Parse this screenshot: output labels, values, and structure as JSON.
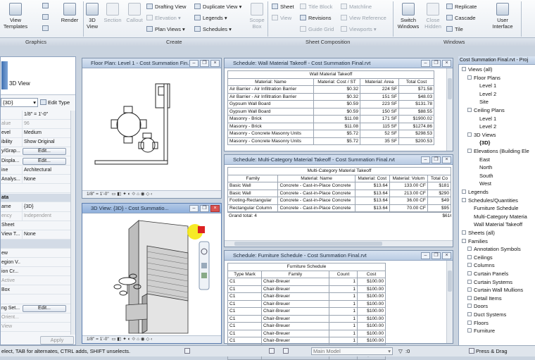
{
  "ribbon": {
    "graphics_title": "Graphics",
    "create_title": "Create",
    "sheet_title": "Sheet Composition",
    "windows_title": "Windows",
    "view_templates": "View\nTemplates",
    "render": "Render",
    "view_3d": "3D\nView",
    "section": "Section",
    "callout": "Callout",
    "drafting_view": "Drafting View",
    "elevation": "Elevation",
    "plan_views": "Plan Views",
    "duplicate_view": "Duplicate View",
    "legends": "Legends",
    "schedules": "Schedules",
    "scope_box": "Scope\nBox",
    "sheet": "Sheet",
    "view": "View",
    "title_block": "Title Block",
    "revisions": "Revisions",
    "guide_grid": "Guide Grid",
    "matchline": "Matchline",
    "view_reference": "View Reference",
    "viewports": "Viewports",
    "switch_windows": "Switch\nWindows",
    "close_hidden": "Close\nHidden",
    "replicate": "Replicate",
    "cascade": "Cascade",
    "tile": "Tile",
    "user_interface": "User\nInterface"
  },
  "properties": {
    "type_name": "3D View",
    "view_selector": "{3D}",
    "edit_type": "Edit Type",
    "rows": [
      {
        "k": "",
        "v": "1/8\" = 1'-0\"",
        "t": "field"
      },
      {
        "k": "alue",
        "v": "96",
        "t": "dim"
      },
      {
        "k": "evel",
        "v": "Medium",
        "t": "field"
      },
      {
        "k": "ibility",
        "v": "Show Original",
        "t": "field"
      },
      {
        "k": "y/Grap...",
        "v": "Edit...",
        "t": "btn"
      },
      {
        "k": "Displa...",
        "v": "Edit...",
        "t": "btn"
      },
      {
        "k": "ine",
        "v": "Architectural",
        "t": "field"
      },
      {
        "k": "Analys...",
        "v": "None",
        "t": "field"
      },
      {
        "k": "",
        "v": "",
        "t": "field"
      },
      {
        "k": "ata",
        "v": "",
        "t": "hdr"
      },
      {
        "k": "ame",
        "v": "{3D}",
        "t": "field"
      },
      {
        "k": "ency",
        "v": "Independent",
        "t": "dim"
      },
      {
        "k": "Sheet",
        "v": "",
        "t": "field"
      },
      {
        "k": "View T...",
        "v": "None",
        "t": "field"
      },
      {
        "k": "",
        "v": "",
        "t": "hdr"
      },
      {
        "k": "ew",
        "v": "",
        "t": "field"
      },
      {
        "k": "egion V...",
        "v": "",
        "t": "field"
      },
      {
        "k": "ion Cr...",
        "v": "",
        "t": "field"
      },
      {
        "k": "Active",
        "v": "",
        "t": "dim"
      },
      {
        "k": "Box",
        "v": "",
        "t": "field"
      },
      {
        "k": "",
        "v": "",
        "t": "field"
      },
      {
        "k": "ng Set...",
        "v": "Edit...",
        "t": "btn"
      },
      {
        "k": "Orient...",
        "v": "",
        "t": "dim"
      },
      {
        "k": "View",
        "v": "",
        "t": "dim"
      }
    ],
    "apply": "Apply"
  },
  "floor_plan": {
    "title": "Floor Plan: Level 1 - Cost Summation Fin...",
    "scale": "1/8\" = 1'-0\""
  },
  "view3d": {
    "title": "3D View: {3D} - Cost Summatio...",
    "scale": "1/8\" = 1'-0\""
  },
  "wall_takeoff": {
    "title": "Schedule: Wall Material Takeoff - Cost Summation Final.rvt",
    "heading": "Wall Material Takeoff",
    "columns": [
      "Material: Name",
      "Material: Cost / ST",
      "Material: Area",
      "Total Cost"
    ],
    "rows": [
      [
        "Air Barrier - Air Infiltration Barrier",
        "$0.32",
        "224 SF",
        "$71.58"
      ],
      [
        "Air Barrier - Air Infiltration Barrier",
        "$0.32",
        "151 SF",
        "$48.03"
      ],
      [
        "Gypsum Wall Board",
        "$0.59",
        "223 SF",
        "$131.78"
      ],
      [
        "Gypsum Wall Board",
        "$0.59",
        "150 SF",
        "$88.55"
      ],
      [
        "Masonry - Brick",
        "$11.08",
        "171 SF",
        "$1900.02"
      ],
      [
        "Masonry - Brick",
        "$11.08",
        "115 SF",
        "$1274.86"
      ],
      [
        "Masonry - Concrete Masonry Units",
        "$5.72",
        "52 SF",
        "$298.53"
      ],
      [
        "Masonry - Concrete Masonry Units",
        "$5.72",
        "35 SF",
        "$200.53"
      ]
    ]
  },
  "multi_takeoff": {
    "title": "Schedule: Multi-Category Material Takeoff - Cost Summation Final.rvt",
    "heading": "Multi-Category Material Takeoff",
    "columns": [
      "Family",
      "Material: Name",
      "Material: Cost",
      "Material: Volum",
      "Total Co"
    ],
    "rows": [
      [
        "Basic Wall",
        "Concrete - Cast-in-Place Concrete",
        "$13.64",
        "133.00 CF",
        "$181"
      ],
      [
        "Basic Wall",
        "Concrete - Cast-in-Place Concrete",
        "$13.64",
        "213.00 CF",
        "$290"
      ],
      [
        "Footing-Rectangular",
        "Concrete - Cast-in-Place Concrete",
        "$13.64",
        "36.00 CF",
        "$49"
      ],
      [
        "Rectangular Column",
        "Concrete - Cast-in-Place Concrete",
        "$13.64",
        "70.00 CF",
        "$95"
      ]
    ],
    "grand_total": "Grand total: 4",
    "grand_value": "$616"
  },
  "furniture": {
    "title": "Schedule: Furniture Schedule - Cost Summation Final.rvt",
    "heading": "Furniture Schedule",
    "columns": [
      "Type Mark",
      "Family",
      "Count",
      "Cost"
    ],
    "rows": [
      [
        "C1",
        "Chair-Breuer",
        "1",
        "$100.00"
      ],
      [
        "C1",
        "Chair-Breuer",
        "1",
        "$100.00"
      ],
      [
        "C1",
        "Chair-Breuer",
        "1",
        "$100.00"
      ],
      [
        "C1",
        "Chair-Breuer",
        "1",
        "$100.00"
      ],
      [
        "C1",
        "Chair-Breuer",
        "1",
        "$100.00"
      ],
      [
        "C1",
        "Chair-Breuer",
        "1",
        "$100.00"
      ],
      [
        "C1",
        "Chair-Breuer",
        "1",
        "$100.00"
      ],
      [
        "C1",
        "Chair-Breuer",
        "1",
        "$100.00"
      ],
      [
        "C1",
        "Chair-Breuer",
        "1",
        "$100.00"
      ],
      [
        "C1",
        "Chair-Breuer",
        "1",
        "$100.00"
      ],
      [
        "C1",
        "Chair-Breuer",
        "1",
        "$100.00"
      ]
    ]
  },
  "browser": {
    "title": "Cost Summation Final.rvt - Proj",
    "items": [
      {
        "label": "Views (all)",
        "indent": 0,
        "box": true
      },
      {
        "label": "Floor Plans",
        "indent": 1,
        "box": true
      },
      {
        "label": "Level 1",
        "indent": 2,
        "box": false
      },
      {
        "label": "Level 2",
        "indent": 2,
        "box": false
      },
      {
        "label": "Site",
        "indent": 2,
        "box": false
      },
      {
        "label": "Ceiling Plans",
        "indent": 1,
        "box": true
      },
      {
        "label": "Level 1",
        "indent": 2,
        "box": false
      },
      {
        "label": "Level 2",
        "indent": 2,
        "box": false
      },
      {
        "label": "3D Views",
        "indent": 1,
        "box": true
      },
      {
        "label": "{3D}",
        "indent": 2,
        "box": false,
        "bold": true
      },
      {
        "label": "Elevations (Building Ele",
        "indent": 1,
        "box": true
      },
      {
        "label": "East",
        "indent": 2,
        "box": false
      },
      {
        "label": "North",
        "indent": 2,
        "box": false
      },
      {
        "label": "South",
        "indent": 2,
        "box": false
      },
      {
        "label": "West",
        "indent": 2,
        "box": false
      },
      {
        "label": "Legends",
        "indent": 0,
        "box": true
      },
      {
        "label": "Schedules/Quantities",
        "indent": 0,
        "box": true
      },
      {
        "label": "Furniture Schedule",
        "indent": 1,
        "box": false
      },
      {
        "label": "Multi-Category Materia",
        "indent": 1,
        "box": false
      },
      {
        "label": "Wall Material Takeoff",
        "indent": 1,
        "box": false
      },
      {
        "label": "Sheets (all)",
        "indent": 0,
        "box": true
      },
      {
        "label": "Families",
        "indent": 0,
        "box": true
      },
      {
        "label": "Annotation Symbols",
        "indent": 1,
        "box": true
      },
      {
        "label": "Ceilings",
        "indent": 1,
        "box": true
      },
      {
        "label": "Columns",
        "indent": 1,
        "box": true
      },
      {
        "label": "Curtain Panels",
        "indent": 1,
        "box": true
      },
      {
        "label": "Curtain Systems",
        "indent": 1,
        "box": true
      },
      {
        "label": "Curtain Wall Mullions",
        "indent": 1,
        "box": true
      },
      {
        "label": "Detail Items",
        "indent": 1,
        "box": true
      },
      {
        "label": "Doors",
        "indent": 1,
        "box": true
      },
      {
        "label": "Duct Systems",
        "indent": 1,
        "box": true
      },
      {
        "label": "Floors",
        "indent": 1,
        "box": true
      },
      {
        "label": "Furniture",
        "indent": 1,
        "box": true
      }
    ]
  },
  "status": {
    "text": "elect, TAB for alternates, CTRL adds, SHIFT unselects.",
    "model": "Main Model",
    "zero": ":0",
    "press_drag": "Press & Drag"
  }
}
